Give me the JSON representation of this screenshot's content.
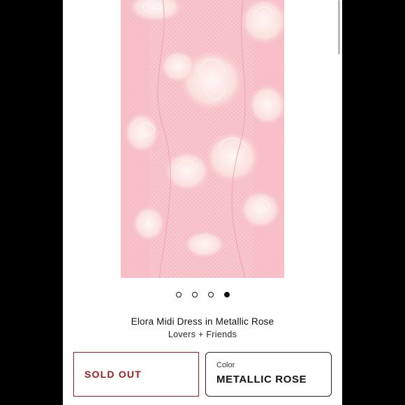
{
  "product": {
    "title": "Elora Midi Dress in Metallic Rose",
    "brand": "Lovers + Friends",
    "image_alt": "pink metallic lace dress detail"
  },
  "carousel": {
    "total_slides": 4,
    "active_index": 3
  },
  "purchase": {
    "status_label": "SOLD OUT",
    "status_color": "#9b1b1b"
  },
  "color_selector": {
    "label": "Color",
    "value": "METALLIC ROSE"
  },
  "theme": {
    "lace_background": "#f9c7ce",
    "lace_highlight": "#fdecec"
  }
}
